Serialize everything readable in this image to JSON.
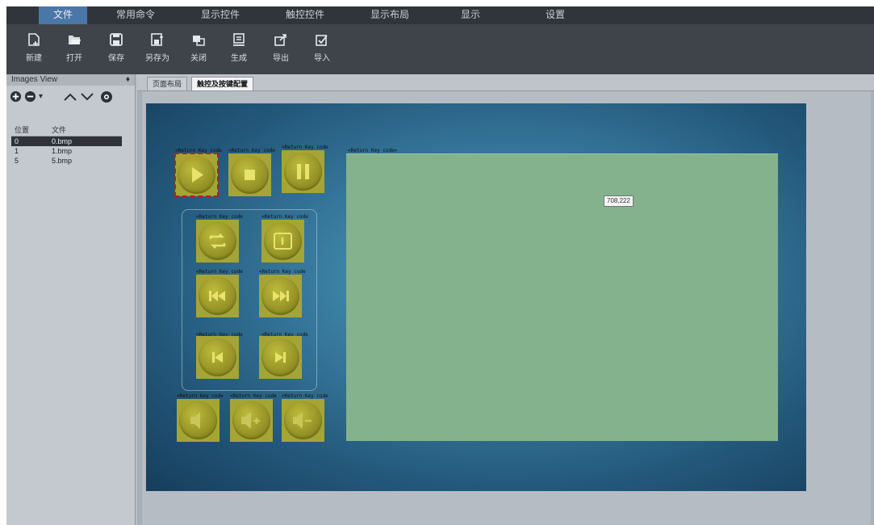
{
  "menu": {
    "tabs": [
      {
        "label": "文件",
        "active": true
      },
      {
        "label": "常用命令",
        "active": false
      },
      {
        "label": "显示控件",
        "active": false
      },
      {
        "label": "触控控件",
        "active": false
      },
      {
        "label": "显示布局",
        "active": false
      },
      {
        "label": "显示",
        "active": false
      },
      {
        "label": "设置",
        "active": false
      }
    ]
  },
  "toolbar": {
    "items": [
      {
        "label": "新建",
        "icon": "new-file-icon"
      },
      {
        "label": "打开",
        "icon": "open-folder-icon"
      },
      {
        "label": "保存",
        "icon": "save-icon"
      },
      {
        "label": "另存为",
        "icon": "save-as-icon"
      },
      {
        "label": "关闭",
        "icon": "close-project-icon"
      },
      {
        "label": "生成",
        "icon": "generate-icon"
      },
      {
        "label": "导出",
        "icon": "export-icon"
      },
      {
        "label": "导入",
        "icon": "import-icon"
      }
    ]
  },
  "panel": {
    "title": "Images View",
    "pin": "♦",
    "table": {
      "headers": [
        "位置",
        "文件"
      ],
      "rows": [
        {
          "pos": "0",
          "file": "0.bmp",
          "selected": true
        },
        {
          "pos": "1",
          "file": "1.bmp",
          "selected": false
        },
        {
          "pos": "5",
          "file": "5.bmp",
          "selected": false
        }
      ]
    }
  },
  "doc": {
    "tabs": [
      {
        "label": "页面布局",
        "active": false
      },
      {
        "label": "触控及按键配置",
        "active": true
      }
    ]
  },
  "canvas": {
    "coord_badge": "708,222",
    "button_label": "<Return Key code",
    "area_label": "<Return Key code>",
    "buttons": [
      {
        "name": "play-button",
        "icon": "play-icon"
      },
      {
        "name": "stop-button",
        "icon": "stop-icon"
      },
      {
        "name": "pause-button",
        "icon": "pause-icon"
      },
      {
        "name": "repeat-button",
        "icon": "repeat-icon"
      },
      {
        "name": "repeat-one-button",
        "icon": "repeat-one-icon"
      },
      {
        "name": "fast-rewind-button",
        "icon": "rewind-icon"
      },
      {
        "name": "fast-forward-button",
        "icon": "fast-forward-icon"
      },
      {
        "name": "previous-track-button",
        "icon": "skip-previous-icon"
      },
      {
        "name": "next-track-button",
        "icon": "skip-next-icon"
      },
      {
        "name": "mute-button",
        "icon": "mute-icon"
      },
      {
        "name": "volume-up-button",
        "icon": "volume-up-icon"
      },
      {
        "name": "volume-down-button",
        "icon": "volume-down-icon"
      }
    ]
  },
  "colors": {
    "menu_bg": "#30353c",
    "active_tab": "#4a77a8",
    "toolbar_bg": "#3f444b",
    "button_fill": "#a5a535",
    "display_area": "#83b28c"
  }
}
